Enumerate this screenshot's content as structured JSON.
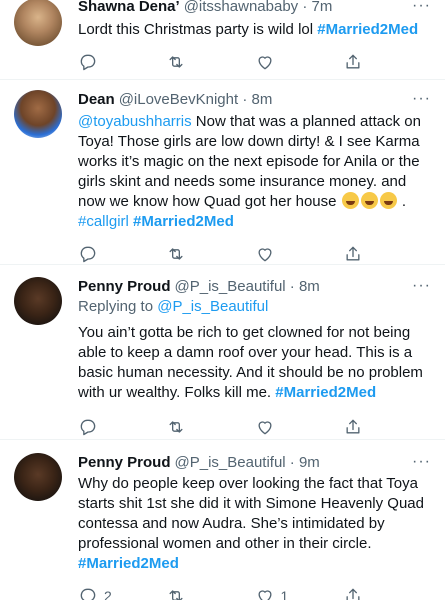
{
  "tweets": [
    {
      "name": "Shawna Dena’",
      "handle": "@itsshawnababy · 7m",
      "text": "Lordt this Christmas party is wild lol ",
      "tag": "#Married2Med"
    },
    {
      "name": "Dean",
      "handle": "@iLoveBevKnight · 8m",
      "mention": "@toyabushharris",
      "text": " Now that was a planned attack on Toya!  Those girls are low down dirty! & I see Karma works it’s magic on the next episode for Anila or the girls skint and needs some insurance money. and now we know how Quad got her house ",
      "after_emoji": " . ",
      "tag1": "#callgirl",
      "tag2": "#Married2Med"
    },
    {
      "name": "Penny Proud",
      "handle": "@P_is_Beautiful · 8m",
      "reply_prefix": "Replying to ",
      "reply_to": "@P_is_Beautiful",
      "text": "You ain’t gotta be rich to get clowned for not being able to keep a damn roof over your head. This is a basic human necessity. And it should be no problem with ur wealthy. Folks kill me. ",
      "tag": "#Married2Med"
    },
    {
      "name": "Penny Proud",
      "handle": "@P_is_Beautiful · 9m",
      "text": "Why do people keep over looking the fact that Toya starts shit 1st she did it with Simone Heavenly Quad contessa and now Audra. She’s intimidated by professional women and other in their circle. ",
      "tag": "#Married2Med",
      "reply_count": "2",
      "like_count": "1"
    }
  ],
  "more_label": "···",
  "icons": {
    "reply": "reply-icon",
    "retweet": "retweet-icon",
    "like": "like-icon",
    "share": "share-icon"
  },
  "colors": {
    "link": "#1d9bf0",
    "muted": "#536471"
  }
}
